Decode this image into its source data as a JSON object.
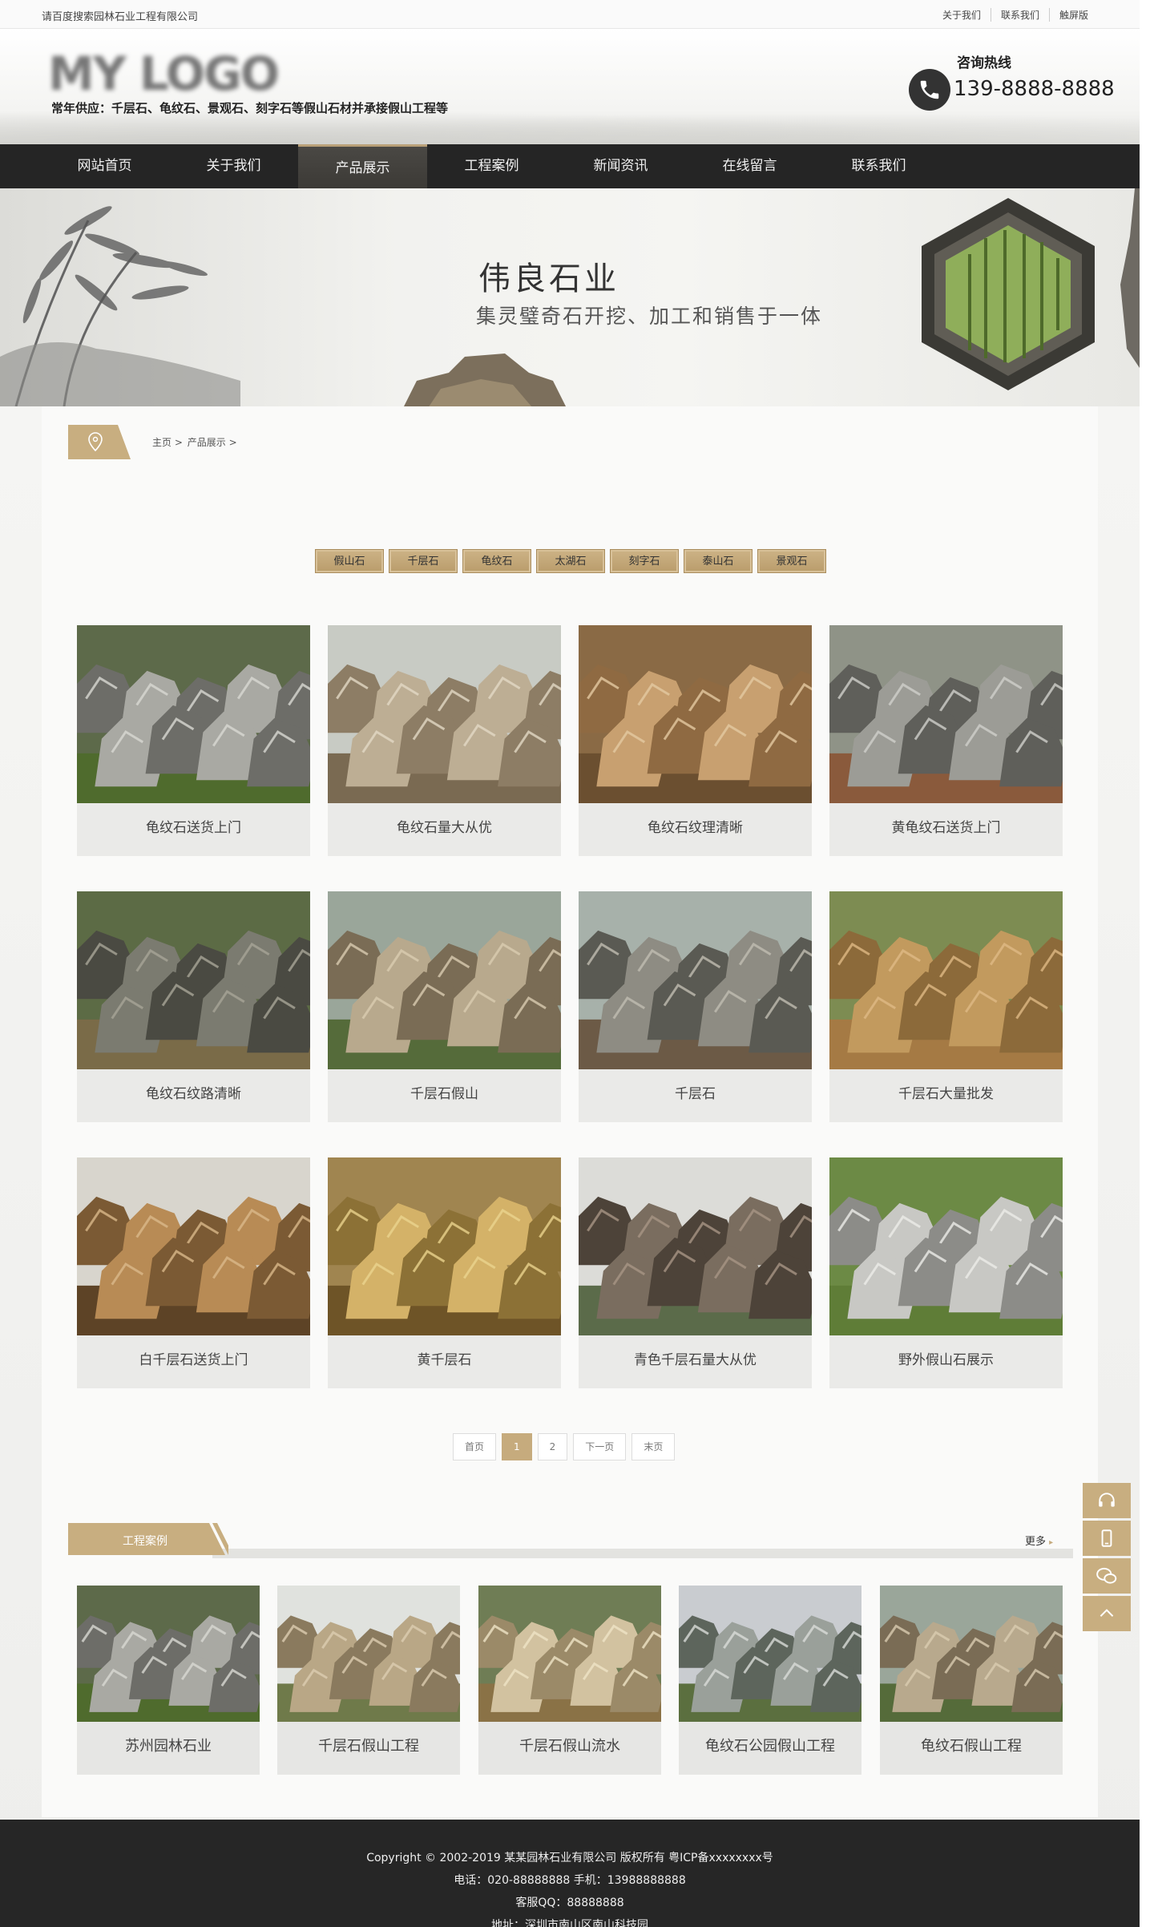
{
  "topbar": {
    "welcome": "请百度搜索园林石业工程有限公司",
    "links": [
      "关于我们",
      "联系我们",
      "触屏版"
    ]
  },
  "header": {
    "logo": "MY LOGO",
    "tagline": "常年供应：千层石、龟纹石、景观石、刻字石等假山石材并承接假山工程等",
    "hotline_label": "咨询热线",
    "phone": "139-8888-8888"
  },
  "nav": {
    "items": [
      "网站首页",
      "关于我们",
      "产品展示",
      "工程案例",
      "新闻资讯",
      "在线留言",
      "联系我们"
    ],
    "active_index": 2
  },
  "banner": {
    "title": "伟良石业",
    "subtitle": "集灵璧奇石开挖、加工和销售于一体"
  },
  "breadcrumb": {
    "home": "主页",
    "sep": ">",
    "current": "产品展示"
  },
  "categories": [
    "假山石",
    "千层石",
    "龟纹石",
    "太湖石",
    "刻字石",
    "泰山石",
    "景观石"
  ],
  "products": [
    {
      "title": "龟纹石送货上门",
      "scene": "grey-rock"
    },
    {
      "title": "龟纹石量大从优",
      "scene": "field-rock"
    },
    {
      "title": "龟纹石纹理清晰",
      "scene": "brown-rock"
    },
    {
      "title": "黄龟纹石送货上门",
      "scene": "grey-field"
    },
    {
      "title": "龟纹石纹路清晰",
      "scene": "forest-rock"
    },
    {
      "title": "千层石假山",
      "scene": "pond-rock"
    },
    {
      "title": "千层石",
      "scene": "garden-pond"
    },
    {
      "title": "千层石大量批发",
      "scene": "quarry"
    },
    {
      "title": "白千层石送货上门",
      "scene": "slab"
    },
    {
      "title": "黄千层石",
      "scene": "yellow-stack"
    },
    {
      "title": "青色千层石量大从优",
      "scene": "dark-rock"
    },
    {
      "title": "野外假山石展示",
      "scene": "white-grass"
    }
  ],
  "pager": [
    "首页",
    "1",
    "2",
    "下一页",
    "末页"
  ],
  "pager_current": "1",
  "cases": {
    "title": "工程案例",
    "more": "更多",
    "items": [
      {
        "title": "苏州园林石业",
        "scene": "grey-rock"
      },
      {
        "title": "千层石假山工程",
        "scene": "tan-rock"
      },
      {
        "title": "千层石假山流水",
        "scene": "water-rock"
      },
      {
        "title": "龟纹石公园假山工程",
        "scene": "park"
      },
      {
        "title": "龟纹石假山工程",
        "scene": "pond-rock"
      }
    ]
  },
  "footer": {
    "copyright": "Copyright © 2002-2019 某某园林石业有限公司 版权所有 粤ICP备xxxxxxxx号",
    "contact": "电话：020-88888888 手机：13988888888",
    "qq": "客服QQ：88888888",
    "address": "地址：深圳市南山区南山科技园"
  },
  "colors": {
    "accent": "#c6ab7d",
    "nav_bg": "#252525",
    "footer_bg": "#262626"
  }
}
